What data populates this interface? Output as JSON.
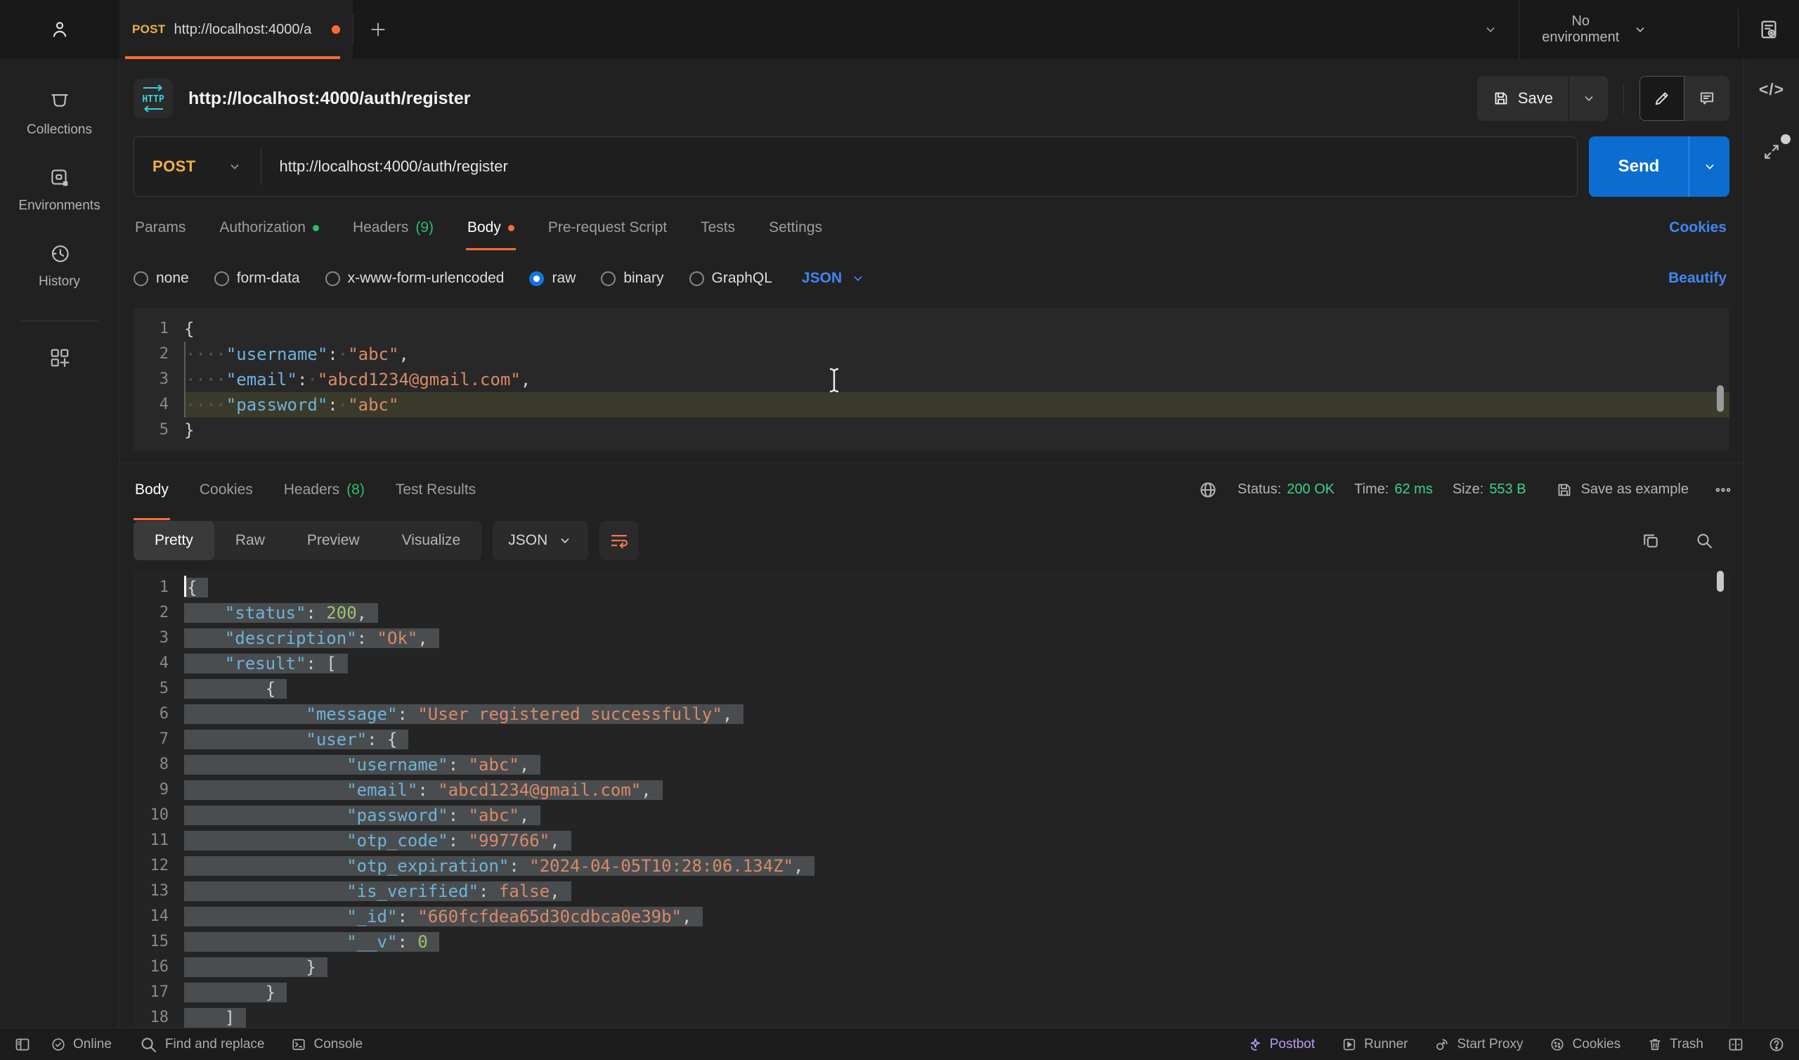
{
  "topbar": {
    "tab_method": "POST",
    "tab_url": "http://localhost:4000/a",
    "environment": "No environment"
  },
  "sidebar": {
    "items": [
      {
        "label": "Collections",
        "icon": "collections-icon"
      },
      {
        "label": "Environments",
        "icon": "environments-icon"
      },
      {
        "label": "History",
        "icon": "history-icon"
      }
    ]
  },
  "request": {
    "title": "http://localhost:4000/auth/register",
    "save_label": "Save",
    "method": "POST",
    "url": "http://localhost:4000/auth/register",
    "send_label": "Send",
    "tabs": [
      {
        "label": "Params"
      },
      {
        "label": "Authorization",
        "dot": "green"
      },
      {
        "label": "Headers",
        "count": "(9)"
      },
      {
        "label": "Body",
        "dot": "orange",
        "active": true
      },
      {
        "label": "Pre-request Script"
      },
      {
        "label": "Tests"
      },
      {
        "label": "Settings"
      }
    ],
    "cookies_link": "Cookies",
    "body_modes": [
      {
        "label": "none"
      },
      {
        "label": "form-data"
      },
      {
        "label": "x-www-form-urlencoded"
      },
      {
        "label": "raw",
        "selected": true
      },
      {
        "label": "binary"
      },
      {
        "label": "GraphQL"
      }
    ],
    "language": "JSON",
    "beautify_link": "Beautify",
    "code_lines": [
      {
        "n": 1,
        "tokens": [
          [
            "p",
            "{"
          ]
        ]
      },
      {
        "n": 2,
        "guide": true,
        "tokens": [
          [
            "d",
            "····"
          ],
          [
            "k",
            "\"username\""
          ],
          [
            "p",
            ":"
          ],
          [
            "d",
            "·"
          ],
          [
            "s",
            "\"abc\""
          ],
          [
            "p",
            ","
          ]
        ]
      },
      {
        "n": 3,
        "guide": true,
        "tokens": [
          [
            "d",
            "····"
          ],
          [
            "k",
            "\"email\""
          ],
          [
            "p",
            ":"
          ],
          [
            "d",
            "·"
          ],
          [
            "s",
            "\"abcd1234@gmail.com\""
          ],
          [
            "p",
            ","
          ]
        ]
      },
      {
        "n": 4,
        "guide": true,
        "hl": true,
        "tokens": [
          [
            "d",
            "····"
          ],
          [
            "k",
            "\"password\""
          ],
          [
            "p",
            ":"
          ],
          [
            "d",
            "·"
          ],
          [
            "s",
            "\"abc\""
          ]
        ]
      },
      {
        "n": 5,
        "tokens": [
          [
            "p",
            "}"
          ]
        ]
      }
    ]
  },
  "response": {
    "tabs": [
      {
        "label": "Body",
        "active": true
      },
      {
        "label": "Cookies"
      },
      {
        "label": "Headers",
        "count": "(8)"
      },
      {
        "label": "Test Results"
      }
    ],
    "status_label": "Status:",
    "status_value": "200 OK",
    "time_label": "Time:",
    "time_value": "62 ms",
    "size_label": "Size:",
    "size_value": "553 B",
    "save_as_example": "Save as example",
    "views": [
      {
        "label": "Pretty",
        "active": true
      },
      {
        "label": "Raw"
      },
      {
        "label": "Preview"
      },
      {
        "label": "Visualize"
      }
    ],
    "language": "JSON",
    "code_lines": [
      {
        "n": 1,
        "sel": true,
        "caret": true,
        "tokens": [
          [
            "p",
            "{"
          ]
        ]
      },
      {
        "n": 2,
        "sel": true,
        "tokens": [
          [
            "w",
            "    "
          ],
          [
            "k",
            "\"status\""
          ],
          [
            "p",
            ": "
          ],
          [
            "n",
            "200"
          ],
          [
            "p",
            ","
          ]
        ]
      },
      {
        "n": 3,
        "sel": true,
        "tokens": [
          [
            "w",
            "    "
          ],
          [
            "k",
            "\"description\""
          ],
          [
            "p",
            ": "
          ],
          [
            "s",
            "\"Ok\""
          ],
          [
            "p",
            ","
          ]
        ]
      },
      {
        "n": 4,
        "sel": true,
        "tokens": [
          [
            "w",
            "    "
          ],
          [
            "k",
            "\"result\""
          ],
          [
            "p",
            ": ["
          ]
        ]
      },
      {
        "n": 5,
        "sel": true,
        "tokens": [
          [
            "w",
            "        "
          ],
          [
            "p",
            "{"
          ]
        ]
      },
      {
        "n": 6,
        "sel": true,
        "tokens": [
          [
            "w",
            "            "
          ],
          [
            "k",
            "\"message\""
          ],
          [
            "p",
            ": "
          ],
          [
            "s",
            "\"User registered successfully\""
          ],
          [
            "p",
            ","
          ]
        ]
      },
      {
        "n": 7,
        "sel": true,
        "tokens": [
          [
            "w",
            "            "
          ],
          [
            "k",
            "\"user\""
          ],
          [
            "p",
            ": {"
          ]
        ]
      },
      {
        "n": 8,
        "sel": true,
        "tokens": [
          [
            "w",
            "                "
          ],
          [
            "k",
            "\"username\""
          ],
          [
            "p",
            ": "
          ],
          [
            "s",
            "\"abc\""
          ],
          [
            "p",
            ","
          ]
        ]
      },
      {
        "n": 9,
        "sel": true,
        "tokens": [
          [
            "w",
            "                "
          ],
          [
            "k",
            "\"email\""
          ],
          [
            "p",
            ": "
          ],
          [
            "s",
            "\"abcd1234@gmail.com\""
          ],
          [
            "p",
            ","
          ]
        ]
      },
      {
        "n": 10,
        "sel": true,
        "tokens": [
          [
            "w",
            "                "
          ],
          [
            "k",
            "\"password\""
          ],
          [
            "p",
            ": "
          ],
          [
            "s",
            "\"abc\""
          ],
          [
            "p",
            ","
          ]
        ]
      },
      {
        "n": 11,
        "sel": true,
        "tokens": [
          [
            "w",
            "                "
          ],
          [
            "k",
            "\"otp_code\""
          ],
          [
            "p",
            ": "
          ],
          [
            "s",
            "\"997766\""
          ],
          [
            "p",
            ","
          ]
        ]
      },
      {
        "n": 12,
        "sel": true,
        "tokens": [
          [
            "w",
            "                "
          ],
          [
            "k",
            "\"otp_expiration\""
          ],
          [
            "p",
            ": "
          ],
          [
            "s",
            "\"2024-04-05T10:28:06.134Z\""
          ],
          [
            "p",
            ","
          ]
        ]
      },
      {
        "n": 13,
        "sel": true,
        "tokens": [
          [
            "w",
            "                "
          ],
          [
            "k",
            "\"is_verified\""
          ],
          [
            "p",
            ": "
          ],
          [
            "b",
            "false"
          ],
          [
            "p",
            ","
          ]
        ]
      },
      {
        "n": 14,
        "sel": true,
        "tokens": [
          [
            "w",
            "                "
          ],
          [
            "k",
            "\"_id\""
          ],
          [
            "p",
            ": "
          ],
          [
            "s",
            "\"660fcfdea65d30cdbca0e39b\""
          ],
          [
            "p",
            ","
          ]
        ]
      },
      {
        "n": 15,
        "sel": true,
        "tokens": [
          [
            "w",
            "                "
          ],
          [
            "k",
            "\"__v\""
          ],
          [
            "p",
            ": "
          ],
          [
            "n",
            "0"
          ]
        ]
      },
      {
        "n": 16,
        "sel": true,
        "tokens": [
          [
            "w",
            "            "
          ],
          [
            "p",
            "}"
          ]
        ]
      },
      {
        "n": 17,
        "sel": true,
        "tokens": [
          [
            "w",
            "        "
          ],
          [
            "p",
            "}"
          ]
        ]
      },
      {
        "n": 18,
        "sel": true,
        "tokens": [
          [
            "w",
            "    "
          ],
          [
            "p",
            "]"
          ]
        ]
      }
    ]
  },
  "statusbar": {
    "left": [
      {
        "label": "Online",
        "icon": "check-circle-icon"
      },
      {
        "label": "Find and replace",
        "icon": "search-icon"
      },
      {
        "label": "Console",
        "icon": "terminal-icon"
      }
    ],
    "right": [
      {
        "label": "Postbot",
        "icon": "sparkle-icon",
        "accent": true
      },
      {
        "label": "Runner",
        "icon": "runner-icon"
      },
      {
        "label": "Start Proxy",
        "icon": "proxy-icon"
      },
      {
        "label": "Cookies",
        "icon": "cookie-icon"
      },
      {
        "label": "Trash",
        "icon": "trash-icon"
      }
    ]
  },
  "colors": {
    "accent_orange": "#ff6c37",
    "link_blue": "#4187f5",
    "send_blue": "#0b6dd0",
    "status_green": "#3ad489",
    "method_yellow": "#edb347",
    "postbot_purple": "#b79df2"
  }
}
